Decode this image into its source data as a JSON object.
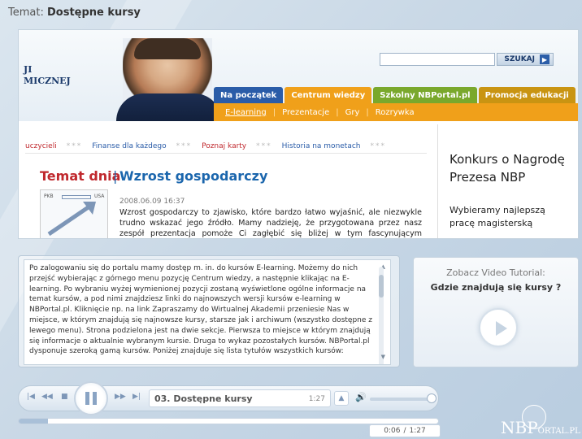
{
  "topic": {
    "prefix": "Temat: ",
    "title": "Dostępne kursy"
  },
  "site_logo_lines": [
    "JI",
    "MICZNEJ"
  ],
  "search": {
    "placeholder": "",
    "button_label": "SZUKAJ"
  },
  "nav_tabs": [
    {
      "label": "Na początek",
      "color": "#2a5ca8"
    },
    {
      "label": "Centrum wiedzy",
      "color": "#f0a01a"
    },
    {
      "label": "Szkolny NBPortal.pl",
      "color": "#7aa82c"
    },
    {
      "label": "Promocja edukacji",
      "color": "#c99412"
    }
  ],
  "subnav": [
    "E-learning",
    "Prezentacje",
    "Gry",
    "Rozrywka"
  ],
  "link_row": [
    "uczycieli",
    "Finanse dla każdego",
    "Poznaj karty",
    "Historia na monetach"
  ],
  "article": {
    "section": "Temat dnia",
    "title": "Wzrost gospodarczy",
    "thumb_labels": [
      "PKB",
      "USA"
    ],
    "date": "2008.06.09 16:37",
    "body": "Wzrost gospodarczy to zjawisko, które bardzo łatwo wyjaśnić, ale niezwykle trudno wskazać jego źródło. Mamy nadzieję, że przygotowana przez nasz zespół prezentacja pomoże Ci zagłębić się bliżej w tym fascynującym zjawiskiem."
  },
  "konkurs": {
    "title": "Konkurs o Nagrodę Prezesa NBP",
    "sub": "Wybieramy najlepszą pracę magisterską"
  },
  "description": "Po zalogowaniu się do portalu mamy dostęp m. in. do kursów E-learning. Możemy do nich przejść wybierając z górnego menu pozycję Centrum wiedzy, a następnie klikając na E-learning. Po wybraniu wyżej wymienionej pozycji zostaną wyświetlone ogólne informacje na temat kursów, a pod nimi znajdziesz linki do najnowszych wersji kursów e-learning w NBPortal.pl. Kliknięcie np. na link Zapraszamy do Wirtualnej Akademii przeniesie Nas w miejsce, w którym znajdują się najnowsze kursy, starsze jak i archiwum (wszystko dostępne z lewego menu). Strona podzielona jest na dwie sekcje. Pierwsza to miejsce w którym znajdują się informacje o aktualnie wybranym kursie. Druga to wykaz pozostałych kursów. NBPortal.pl dysponuje szeroką gamą kursów. Poniżej znajduje się lista tytułów wszystkich kursów:",
  "video": {
    "caption": "Zobacz Video Tutorial:",
    "title": "Gdzie znajdują się kursy ?"
  },
  "player": {
    "track_name": "03. Dostępne kursy",
    "track_length": "1:27",
    "current_time": "0:06",
    "time_separator": "/",
    "total_time": "1:27",
    "progress_fraction": 0.069,
    "volume_fraction": 1.0
  },
  "brand": {
    "main": "NBP",
    "suffix": "ORTAL.PL"
  }
}
